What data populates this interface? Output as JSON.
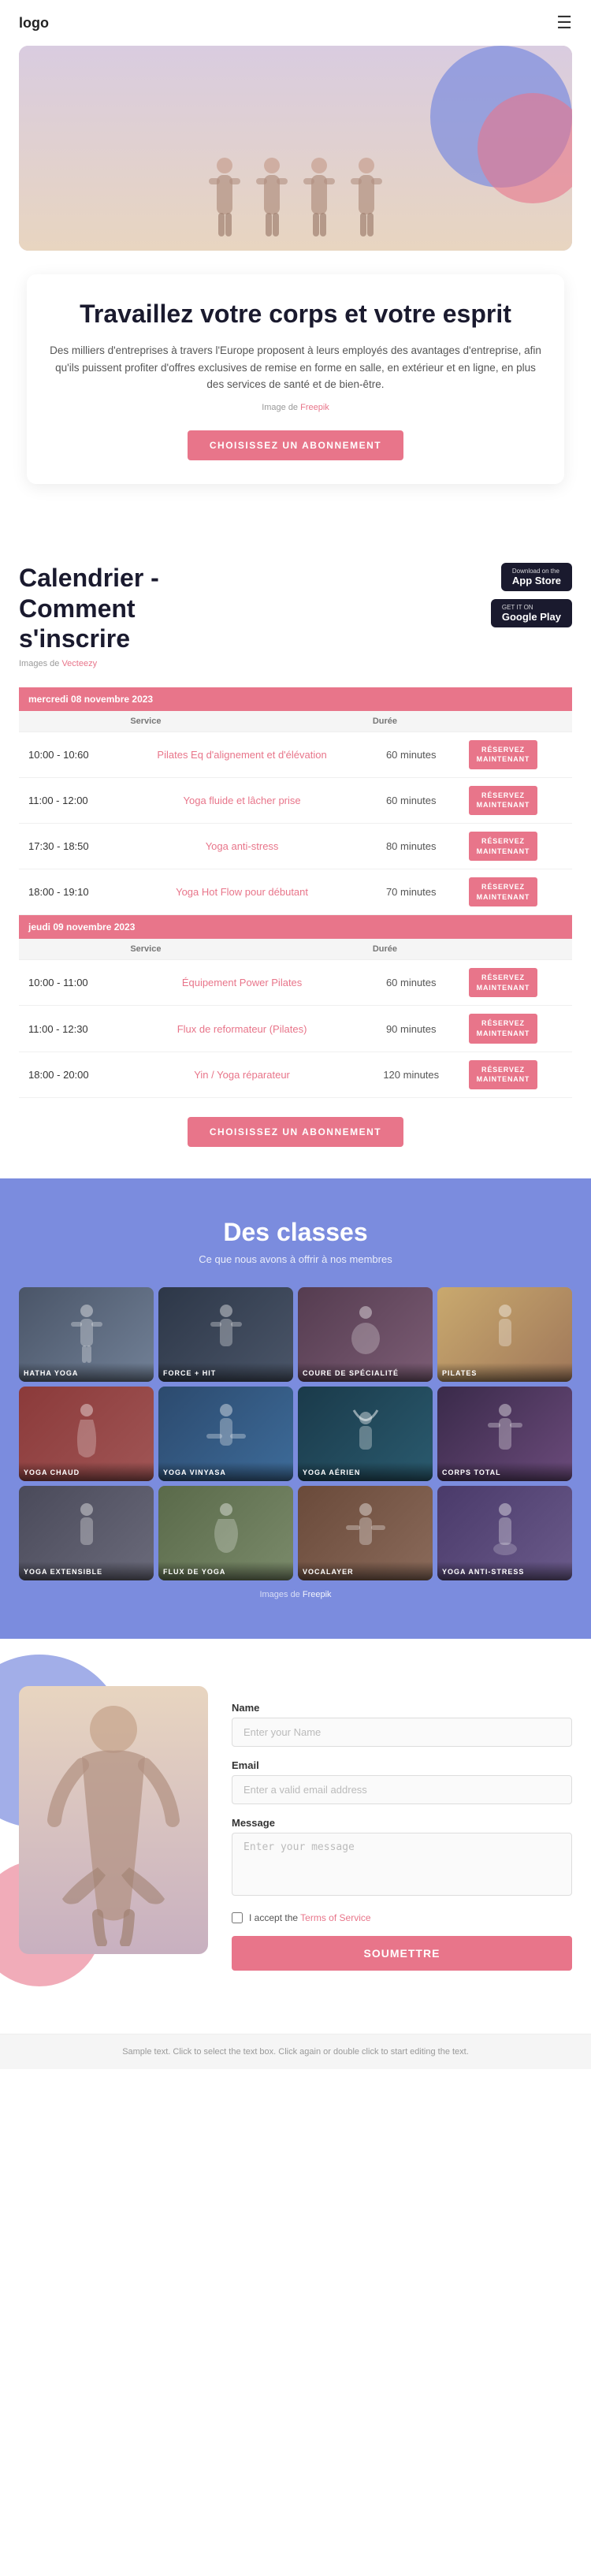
{
  "header": {
    "logo": "logo",
    "menu_icon": "☰"
  },
  "hero": {
    "title": "Travaillez votre corps et votre esprit",
    "description": "Des milliers d'entreprises à travers l'Europe proposent à leurs employés des avantages d'entreprise, afin qu'ils puissent profiter d'offres exclusives de remise en forme en salle, en extérieur et en ligne, en plus des services de santé et de bien-être.",
    "image_credit_prefix": "Image de",
    "image_credit_link": "Freepik",
    "cta_button": "CHOISISSEZ UN ABONNEMENT"
  },
  "calendar": {
    "title_line1": "Calendrier -",
    "title_line2": "Comment",
    "title_line3": "s'inscrire",
    "image_credit_prefix": "Images de",
    "image_credit_link": "Vecteezy",
    "app_store_top": "Download on the",
    "app_store_main": "App Store",
    "google_play_top": "GET IT ON",
    "google_play_main": "Google Play",
    "table_headers": [
      "",
      "Service",
      "Durée",
      ""
    ],
    "day1": "mercredi 08 novembre 2023",
    "day2": "jeudi 09 novembre 2023",
    "rows_day1": [
      {
        "time": "10:00 - 10:60",
        "service": "Pilates Eq d'alignement et d'élévation",
        "duration": "60 minutes",
        "reserve": "RÉSERVEZ\nMAINTENANT"
      },
      {
        "time": "11:00 - 12:00",
        "service": "Yoga fluide et lâcher prise",
        "duration": "60 minutes",
        "reserve": "RÉSERVEZ\nMAINTENANT"
      },
      {
        "time": "17:30 - 18:50",
        "service": "Yoga anti-stress",
        "duration": "80 minutes",
        "reserve": "RÉSERVEZ\nMAINTENANT"
      },
      {
        "time": "18:00 - 19:10",
        "service": "Yoga Hot Flow pour débutant",
        "duration": "70 minutes",
        "reserve": "RÉSERVEZ\nMAINTENANT"
      }
    ],
    "rows_day2": [
      {
        "time": "10:00 - 11:00",
        "service": "Équipement Power Pilates",
        "duration": "60 minutes",
        "reserve": "RÉSERVEZ\nMAINTENANT"
      },
      {
        "time": "11:00 - 12:30",
        "service": "Flux de reformateur (Pilates)",
        "duration": "90 minutes",
        "reserve": "RÉSERVEZ\nMAINTENANT"
      },
      {
        "time": "18:00 - 20:00",
        "service": "Yin / Yoga réparateur",
        "duration": "120 minutes",
        "reserve": "RÉSERVEZ\nMAINTENANT"
      }
    ],
    "cta_button": "CHOISISSEZ UN ABONNEMENT"
  },
  "classes": {
    "title": "Des classes",
    "subtitle": "Ce que nous avons à offrir à nos membres",
    "image_credit_prefix": "Images de",
    "image_credit_link": "Freepik",
    "items": [
      {
        "label": "HATHA YOGA",
        "color_class": "cc1"
      },
      {
        "label": "FORCE + HIT",
        "color_class": "cc2"
      },
      {
        "label": "COURE DE SPÉCIALITÉ",
        "color_class": "cc3"
      },
      {
        "label": "PILATES",
        "color_class": "cc4"
      },
      {
        "label": "YOGA CHAUD",
        "color_class": "cc5"
      },
      {
        "label": "YOGA VINYASA",
        "color_class": "cc6"
      },
      {
        "label": "YOGA AÉRIEN",
        "color_class": "cc7"
      },
      {
        "label": "CORPS TOTAL",
        "color_class": "cc8"
      },
      {
        "label": "YOGA EXTENSIBLE",
        "color_class": "cc9"
      },
      {
        "label": "FLUX DE YOGA",
        "color_class": "cc10"
      },
      {
        "label": "VOCALAYER",
        "color_class": "cc11"
      },
      {
        "label": "YOGA ANTI-STRESS",
        "color_class": "cc12"
      }
    ]
  },
  "contact": {
    "form": {
      "name_label": "Name",
      "name_placeholder": "Enter your Name",
      "email_label": "Email",
      "email_placeholder": "Enter a valid email address",
      "message_label": "Message",
      "message_placeholder": "Enter your message",
      "checkbox_text": "I accept the",
      "checkbox_link": "Terms of Service",
      "submit_button": "SOUMETTRE"
    }
  },
  "footer": {
    "text": "Sample text. Click to select the text box. Click again or double click to start editing the text."
  }
}
